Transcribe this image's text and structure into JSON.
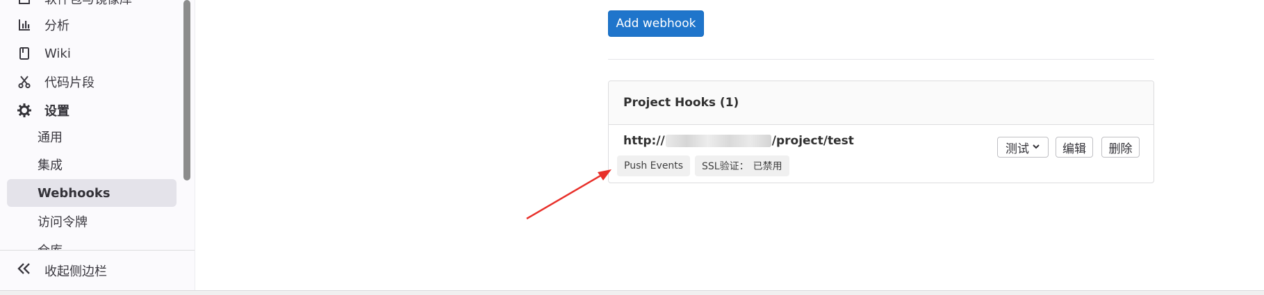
{
  "sidebar": {
    "items": [
      {
        "label": "软件包与镜像库",
        "icon": "package-icon"
      },
      {
        "label": "分析",
        "icon": "chart-icon"
      },
      {
        "label": "Wiki",
        "icon": "book-icon"
      },
      {
        "label": "代码片段",
        "icon": "scissors-icon"
      },
      {
        "label": "设置",
        "icon": "gear-icon"
      },
      {
        "label": "通用"
      },
      {
        "label": "集成"
      },
      {
        "label": "Webhooks"
      },
      {
        "label": "访问令牌"
      },
      {
        "label": "仓库"
      }
    ],
    "collapse_label": "收起侧边栏"
  },
  "main": {
    "add_webhook_label": "Add webhook",
    "hooks_header": "Project Hooks (1)",
    "hook": {
      "url_prefix": "http://",
      "url_suffix": "/project/test",
      "badge_push": "Push Events",
      "badge_ssl_label": "SSL验证：",
      "badge_ssl_value": "已禁用",
      "test_label": "测试",
      "edit_label": "编辑",
      "delete_label": "删除"
    }
  },
  "colors": {
    "primary": "#1f75cb",
    "annotation_arrow": "#e8302a",
    "active_nav_bg": "#e4e3ea"
  }
}
